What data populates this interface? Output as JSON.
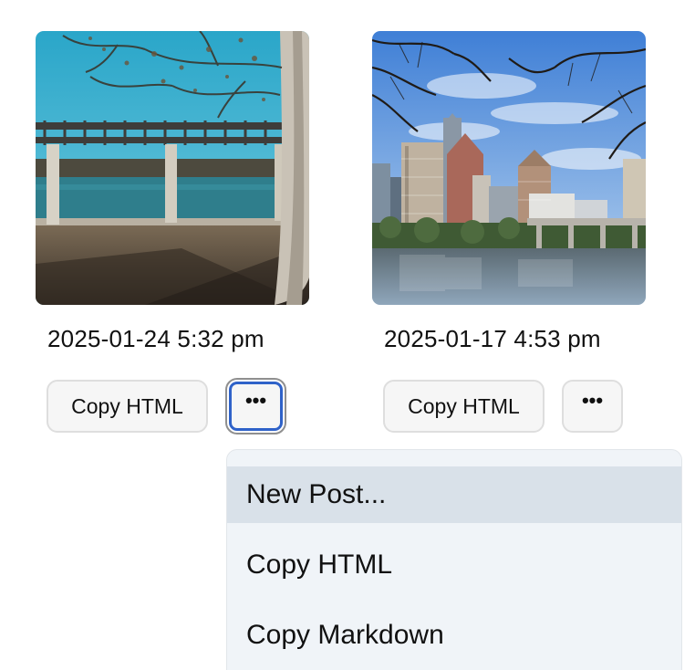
{
  "photos": [
    {
      "image": "park-pergola-lake-photo",
      "timestamp": "2025-01-24 5:32 pm",
      "copy_html_label": "Copy HTML",
      "more_label": "•••",
      "more_focused": true
    },
    {
      "image": "city-skyline-river-photo",
      "timestamp": "2025-01-17 4:53 pm",
      "copy_html_label": "Copy HTML",
      "more_label": "•••",
      "more_focused": false
    }
  ],
  "menu": {
    "items": [
      {
        "label": "New Post...",
        "highlighted": true
      },
      {
        "label": "Copy HTML",
        "highlighted": false
      },
      {
        "label": "Copy Markdown",
        "highlighted": false
      }
    ]
  },
  "colors": {
    "focus_ring": "#2f62c9",
    "menu_background": "#f0f4f8",
    "menu_highlight": "#d9e1e9",
    "button_background": "#f6f6f6"
  }
}
